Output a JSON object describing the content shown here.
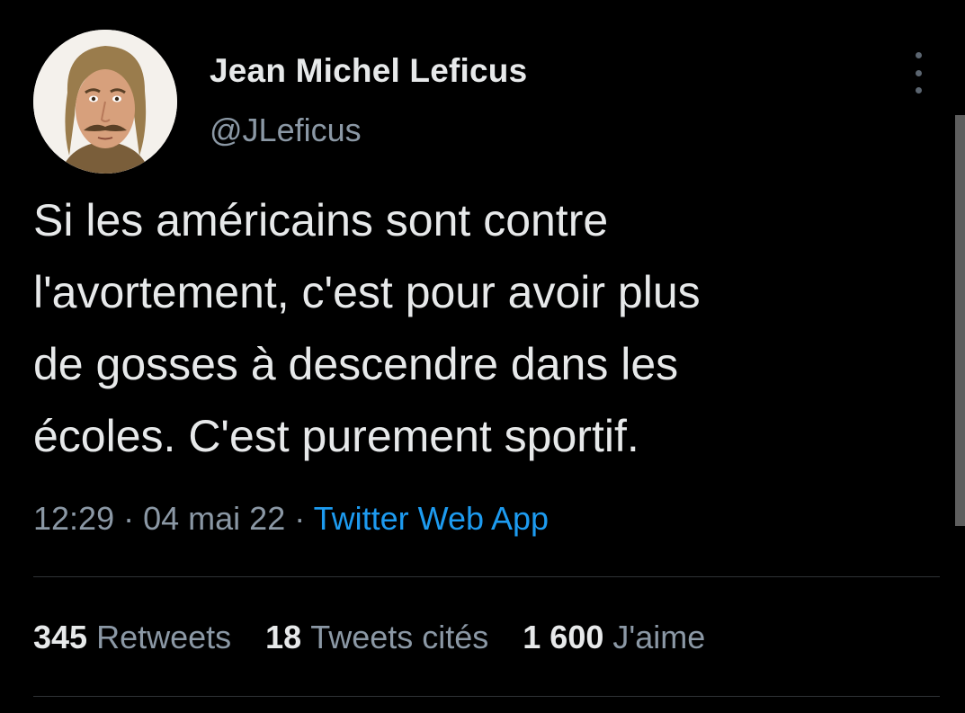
{
  "author": {
    "name": "Jean Michel Leficus",
    "handle": "@JLeficus"
  },
  "tweet": {
    "lines": [
      "Si les américains sont contre",
      "l'avortement, c'est pour avoir plus",
      "de gosses à descendre dans les",
      "écoles. C'est purement sportif."
    ],
    "time": "12:29",
    "date": "04 mai 22",
    "separator": "·",
    "source": "Twitter Web App"
  },
  "stats": {
    "retweets": {
      "count": "345",
      "label": "Retweets"
    },
    "quotes": {
      "count": "18",
      "label": "Tweets cités"
    },
    "likes": {
      "count": "1 600",
      "label": "J'aime"
    }
  },
  "icons": {
    "more": "more-vertical-icon"
  },
  "colors": {
    "background": "#000000",
    "text": "#e7e9ea",
    "muted": "#8b98a5",
    "link": "#1d9bf0",
    "divider": "#2f3336"
  }
}
